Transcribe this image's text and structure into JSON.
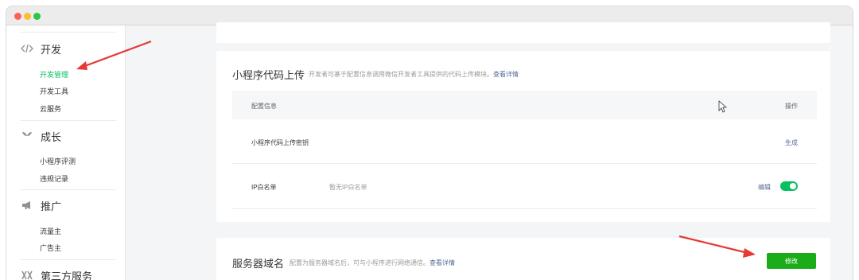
{
  "sidebar": {
    "groups": [
      {
        "title": "开发",
        "icon": "code-icon",
        "items": [
          {
            "label": "开发管理",
            "active": true
          },
          {
            "label": "开发工具",
            "active": false
          },
          {
            "label": "云服务",
            "active": false
          }
        ]
      },
      {
        "title": "成长",
        "icon": "sprout-icon",
        "items": [
          {
            "label": "小程序评测",
            "active": false
          },
          {
            "label": "违规记录",
            "active": false
          }
        ]
      },
      {
        "title": "推广",
        "icon": "megaphone-icon",
        "items": [
          {
            "label": "流量主",
            "active": false
          },
          {
            "label": "广告主",
            "active": false
          }
        ]
      },
      {
        "title": "第三方服务",
        "icon": "third-party-icon",
        "items": []
      }
    ]
  },
  "upload_card": {
    "title": "小程序代码上传",
    "description": "开发者可基于配置信息调用微信开发者工具提供的代码上传模块。",
    "details_link": "查看详情",
    "columns": {
      "config": "配置信息",
      "action": "操作"
    },
    "rows": [
      {
        "name": "小程序代码上传密钥",
        "value": "",
        "action": "生成"
      },
      {
        "name": "IP白名单",
        "value": "暂无IP白名单",
        "action": "编辑",
        "toggle_on": true
      }
    ]
  },
  "domain_card": {
    "title": "服务器域名",
    "description": "配置为服务器域名后，可与小程序进行网络通信。",
    "details_link": "查看详情",
    "modify_button": "修改"
  },
  "colors": {
    "accent_green": "#07c160",
    "button_green": "#1aad19",
    "link_blue": "#576b95",
    "arrow_red": "#e53935"
  }
}
